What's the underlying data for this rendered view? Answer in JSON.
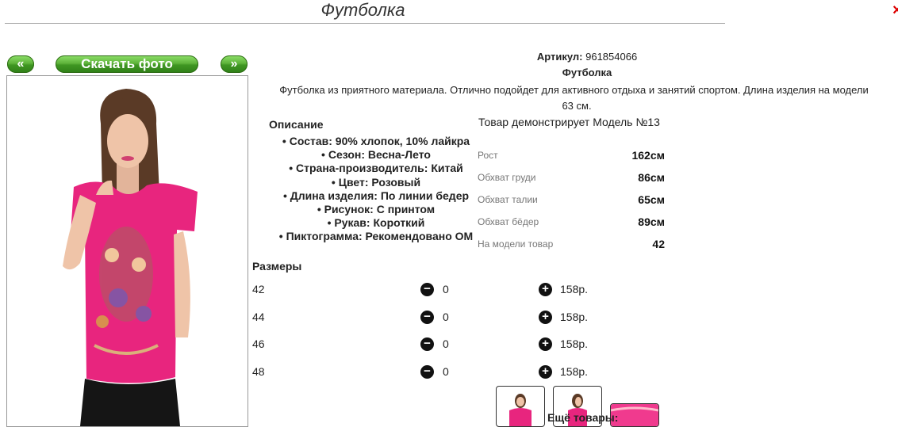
{
  "title": "Футболка",
  "nav": {
    "prev_label": "«",
    "download_label": "Скачать фото",
    "next_label": "»"
  },
  "product": {
    "article_label": "Артикул:",
    "article_value": "961854066",
    "name": "Футболка",
    "description_line1": "Футболка из приятного материала. Отлично подойдет для активного отдыха и занятий спортом. Длина изделия на модели",
    "description_line2": "63 см."
  },
  "description_section": {
    "heading": "Описание",
    "items": [
      "Состав: 90% хлопок, 10% лайкра",
      "Сезон: Весна-Лето",
      "Страна-производитель: Китай",
      "Цвет: Розовый",
      "Длина изделия: По линии бедер",
      "Рисунок: С принтом",
      "Рукав: Короткий",
      "Пиктограмма: Рекомендовано ОМ"
    ]
  },
  "model": {
    "heading": "Товар демонстрирует Модель №13",
    "rows": [
      {
        "label": "Рост",
        "value": "162см"
      },
      {
        "label": "Обхват груди",
        "value": "86см"
      },
      {
        "label": "Обхват талии",
        "value": "65см"
      },
      {
        "label": "Обхват бёдер",
        "value": "89см"
      },
      {
        "label": "На модели товар",
        "value": "42"
      }
    ]
  },
  "sizes": {
    "heading": "Размеры",
    "rows": [
      {
        "size": "42",
        "qty": "0",
        "price": "158р."
      },
      {
        "size": "44",
        "qty": "0",
        "price": "158р."
      },
      {
        "size": "46",
        "qty": "0",
        "price": "158р."
      },
      {
        "size": "48",
        "qty": "0",
        "price": "158р."
      }
    ]
  },
  "more_label": "Ещё товары:",
  "colors": {
    "accent_green": "#4caf2a",
    "shirt_pink": "#e8257e"
  }
}
